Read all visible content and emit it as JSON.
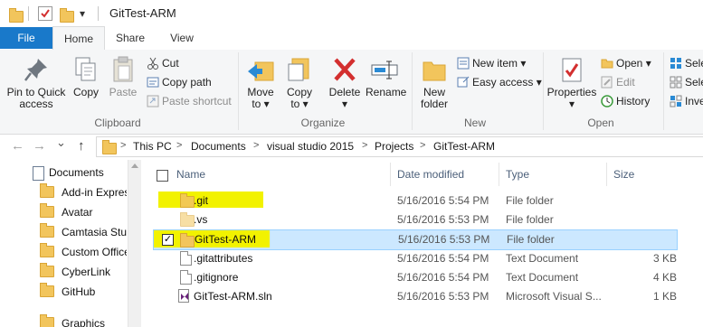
{
  "window": {
    "title": "GitTest-ARM",
    "qat_dropdown_glyph": "▾"
  },
  "tabs": {
    "file": "File",
    "home": "Home",
    "share": "Share",
    "view": "View"
  },
  "ribbon": {
    "clipboard": {
      "label": "Clipboard",
      "pin_line1": "Pin to Quick",
      "pin_line2": "access",
      "copy": "Copy",
      "paste": "Paste",
      "cut": "Cut",
      "copy_path": "Copy path",
      "paste_shortcut": "Paste shortcut"
    },
    "organize": {
      "label": "Organize",
      "move_line1": "Move",
      "move_line2": "to ▾",
      "copy_line1": "Copy",
      "copy_line2": "to ▾",
      "delete": "Delete",
      "delete_arrow": "▾",
      "rename": "Rename"
    },
    "new": {
      "label": "New",
      "new_folder_line1": "New",
      "new_folder_line2": "folder",
      "new_item": "New item ▾",
      "easy_access": "Easy access ▾"
    },
    "open": {
      "label": "Open",
      "properties": "Properties",
      "properties_arrow": "▾",
      "open": "Open ▾",
      "edit": "Edit",
      "history": "History"
    },
    "select": {
      "select_all": "Sele",
      "select_none": "Sele",
      "invert": "Inve"
    }
  },
  "address": {
    "crumbs": [
      "This PC",
      "Documents",
      "visual studio 2015",
      "Projects",
      "GitTest-ARM"
    ],
    "back_glyph": "←",
    "forward_glyph": "→",
    "recent_glyph": "⌄",
    "up_glyph": "↑"
  },
  "nav_pane": {
    "items": [
      "Documents",
      "Add-in Express",
      "Avatar",
      "Camtasia Studi",
      "Custom Office",
      "CyberLink",
      "GitHub",
      "Graphics"
    ]
  },
  "file_list": {
    "columns": {
      "name": "Name",
      "date": "Date modified",
      "type": "Type",
      "size": "Size"
    },
    "rows": [
      {
        "name": ".git",
        "date": "5/16/2016 5:54 PM",
        "type": "File folder",
        "size": "",
        "kind": "folder",
        "highlighted": true,
        "selected": false
      },
      {
        "name": ".vs",
        "date": "5/16/2016 5:53 PM",
        "type": "File folder",
        "size": "",
        "kind": "folder-light",
        "highlighted": false,
        "selected": false
      },
      {
        "name": "GitTest-ARM",
        "date": "5/16/2016 5:53 PM",
        "type": "File folder",
        "size": "",
        "kind": "folder",
        "highlighted": true,
        "selected": true
      },
      {
        "name": ".gitattributes",
        "date": "5/16/2016 5:54 PM",
        "type": "Text Document",
        "size": "3 KB",
        "kind": "doc",
        "highlighted": false,
        "selected": false
      },
      {
        "name": ".gitignore",
        "date": "5/16/2016 5:54 PM",
        "type": "Text Document",
        "size": "4 KB",
        "kind": "doc",
        "highlighted": false,
        "selected": false
      },
      {
        "name": "GitTest-ARM.sln",
        "date": "5/16/2016 5:53 PM",
        "type": "Microsoft Visual S...",
        "size": "1 KB",
        "kind": "sln",
        "highlighted": false,
        "selected": false
      }
    ],
    "checkmark": "✓"
  },
  "colors": {
    "accent": "#1979ca",
    "highlight": "#f2f200",
    "selection": "#cce8ff",
    "folder": "#f2c55c",
    "delete_red": "#d32f2f"
  }
}
